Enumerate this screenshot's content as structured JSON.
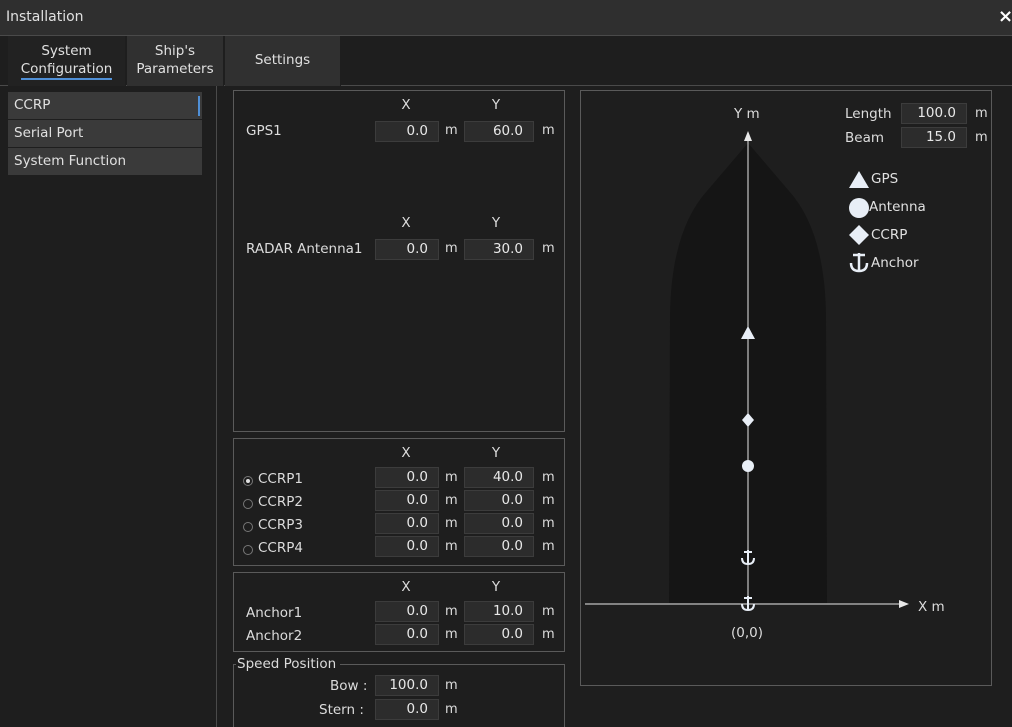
{
  "window": {
    "title": "Installation",
    "close_glyph": "×"
  },
  "tabs": [
    {
      "line1": "System",
      "line2": "Configuration"
    },
    {
      "line1": "Ship's",
      "line2": "Parameters"
    },
    {
      "line1": "Settings"
    }
  ],
  "sidebar": {
    "items": [
      "CCRP",
      "Serial Port",
      "System Function"
    ],
    "active": "CCRP"
  },
  "gps_panel": {
    "x_header": "X",
    "y_header": "Y",
    "gps1": {
      "label": "GPS1",
      "x": "0.0",
      "y": "60.0",
      "unit": "m"
    },
    "antenna": {
      "label": "RADAR Antenna1",
      "x": "0.0",
      "y": "30.0",
      "unit": "m"
    }
  },
  "ccrp_panel": {
    "x_header": "X",
    "y_header": "Y",
    "unit": "m",
    "rows": [
      {
        "label": "CCRP1",
        "x": "0.0",
        "y": "40.0",
        "selected": true
      },
      {
        "label": "CCRP2",
        "x": "0.0",
        "y": "0.0",
        "selected": false
      },
      {
        "label": "CCRP3",
        "x": "0.0",
        "y": "0.0",
        "selected": false
      },
      {
        "label": "CCRP4",
        "x": "0.0",
        "y": "0.0",
        "selected": false
      }
    ]
  },
  "anchor_panel": {
    "x_header": "X",
    "y_header": "Y",
    "unit": "m",
    "rows": [
      {
        "label": "Anchor1",
        "x": "0.0",
        "y": "10.0"
      },
      {
        "label": "Anchor2",
        "x": "0.0",
        "y": "0.0"
      }
    ]
  },
  "speed_panel": {
    "title": "Speed Position",
    "bow": {
      "label": "Bow :",
      "value": "100.0",
      "unit": "m"
    },
    "stern": {
      "label": "Stern :",
      "value": "0.0",
      "unit": "m"
    }
  },
  "diagram": {
    "y_axis_label": "Y m",
    "x_axis_label": "X m",
    "origin_label": "(0,0)",
    "length": {
      "label": "Length",
      "value": "100.0",
      "unit": "m"
    },
    "beam": {
      "label": "Beam",
      "value": "15.0",
      "unit": "m"
    },
    "legend": [
      {
        "icon": "triangle-icon",
        "label": "GPS"
      },
      {
        "icon": "circle-icon",
        "label": "Antenna"
      },
      {
        "icon": "diamond-icon",
        "label": "CCRP"
      },
      {
        "icon": "anchor-icon",
        "label": "Anchor"
      }
    ],
    "colors": {
      "hull": "#151515",
      "marker": "#e8eef6",
      "background": "#1e1e1e"
    }
  }
}
